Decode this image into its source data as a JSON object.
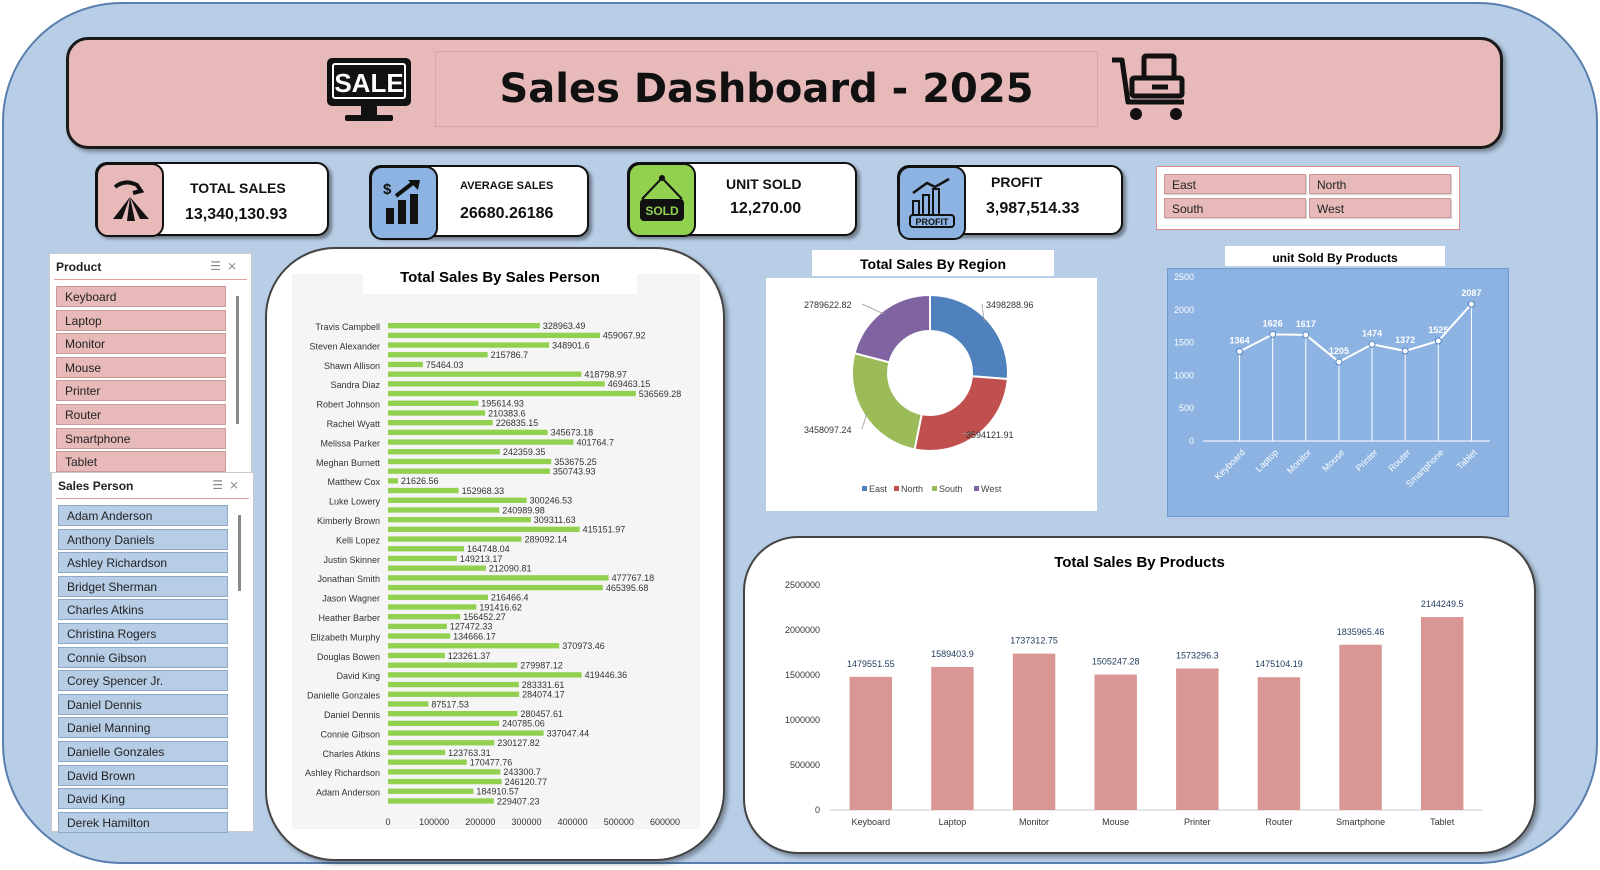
{
  "header": {
    "title": "Sales Dashboard - 2025",
    "sale_badge": "SALE"
  },
  "kpis": {
    "total_sales": {
      "label": "TOTAL SALES",
      "value": "13,340,130.93"
    },
    "average_sales": {
      "label": "AVERAGE SALES",
      "value": "26680.26186"
    },
    "unit_sold": {
      "label": "UNIT SOLD",
      "value": "12,270.00",
      "icon_text": "SOLD"
    },
    "profit": {
      "label": "PROFIT",
      "value": "3,987,514.33",
      "icon_text": "PROFIT"
    }
  },
  "region_slicer": {
    "items": [
      "East",
      "North",
      "South",
      "West"
    ]
  },
  "product_slicer": {
    "title": "Product",
    "items": [
      "Keyboard",
      "Laptop",
      "Monitor",
      "Mouse",
      "Printer",
      "Router",
      "Smartphone",
      "Tablet"
    ]
  },
  "salesperson_slicer": {
    "title": "Sales Person",
    "items": [
      "Adam Anderson",
      "Anthony Daniels",
      "Ashley Richardson",
      "Bridget Sherman",
      "Charles Atkins",
      "Christina Rogers",
      "Connie Gibson",
      "Corey Spencer Jr.",
      "Daniel Dennis",
      "Daniel Manning",
      "Danielle Gonzales",
      "David Brown",
      "David King",
      "Derek Hamilton"
    ]
  },
  "colors": {
    "background": "#b8cde6",
    "header": "#e7b9b9",
    "bar_green": "#92d050",
    "bar_pink": "#da9694",
    "east": "#4f81bd",
    "north": "#c0504d",
    "south": "#9bbb59",
    "west": "#8064a2",
    "line_panel": "#8db3e2"
  },
  "chart_data": [
    {
      "type": "bar",
      "title": "Total Sales By Sales Person",
      "orientation": "horizontal",
      "category_labels": [
        "Travis Campbell",
        "Steven Alexander",
        "Shawn Allison",
        "Sandra Diaz",
        "Robert Johnson",
        "Rachel Wyatt",
        "Melissa Parker",
        "Meghan Burnett",
        "Matthew Cox",
        "Luke Lowery",
        "Kimberly Brown",
        "Kelli Lopez",
        "Justin Skinner",
        "Jonathan Smith",
        "Jason Wagner",
        "Heather Barber",
        "Elizabeth Murphy",
        "Douglas Bowen",
        "David King",
        "Danielle Gonzales",
        "Daniel Dennis",
        "Connie Gibson",
        "Charles Atkins",
        "Ashley Richardson",
        "Adam Anderson"
      ],
      "values": [
        328963.49,
        459067.92,
        348901.6,
        215786.7,
        75464.03,
        418798.97,
        469463.15,
        536569.28,
        195614.93,
        210383.6,
        226835.15,
        345673.18,
        401764.7,
        242359.35,
        353675.25,
        350743.93,
        21626.56,
        152968.33,
        300246.53,
        240989.98,
        309311.63,
        415151.97,
        289092.14,
        164748.04,
        149213.17,
        212090.81,
        477767.18,
        465395.68,
        216466.4,
        191416.62,
        156452.27,
        127472.33,
        134666.17,
        370973.46,
        123261.37,
        279987.12,
        419446.36,
        283331.61,
        284074.17,
        87517.53,
        280457.61,
        240785.06,
        337047.44,
        230127.82,
        123763.31,
        170477.76,
        243300.7,
        246120.77,
        184910.57,
        229407.23
      ],
      "xticks": [
        "0",
        "100000",
        "200000",
        "300000",
        "400000",
        "500000",
        "600000"
      ],
      "xlim": [
        0,
        600000
      ]
    },
    {
      "type": "pie",
      "title": "Total Sales By Region",
      "labels": [
        "East",
        "North",
        "South",
        "West"
      ],
      "values": [
        3498288.96,
        3594121.91,
        3458097.24,
        2789622.82
      ],
      "value_labels": [
        "3498288.96",
        "3594121.91",
        "3458097.24",
        "2789622.82"
      ],
      "donut": true,
      "legend": "bottom"
    },
    {
      "type": "line",
      "title": "unit Sold By Products",
      "categories": [
        "Keyboard",
        "Laptop",
        "Monitor",
        "Mouse",
        "Printer",
        "Router",
        "Smartphone",
        "Tablet"
      ],
      "values": [
        1364,
        1626,
        1617,
        1205,
        1474,
        1372,
        1525,
        2087
      ],
      "yticks": [
        "0",
        "500",
        "1000",
        "1500",
        "2000",
        "2500"
      ],
      "ylim": [
        0,
        2500
      ]
    },
    {
      "type": "bar",
      "title": "Total Sales By Products",
      "categories": [
        "Keyboard",
        "Laptop",
        "Monitor",
        "Mouse",
        "Printer",
        "Router",
        "Smartphone",
        "Tablet"
      ],
      "values": [
        1479551.55,
        1589403.9,
        1737312.75,
        1505247.28,
        1573296.3,
        1475104.19,
        1835965.46,
        2144249.5
      ],
      "value_labels": [
        "1479551.55",
        "1589403.9",
        "1737312.75",
        "1505247.28",
        "1573296.3",
        "1475104.19",
        "1835965.46",
        "2144249.5"
      ],
      "yticks": [
        "0",
        "500000",
        "1000000",
        "1500000",
        "2000000",
        "2500000"
      ],
      "ylim": [
        0,
        2500000
      ]
    }
  ]
}
